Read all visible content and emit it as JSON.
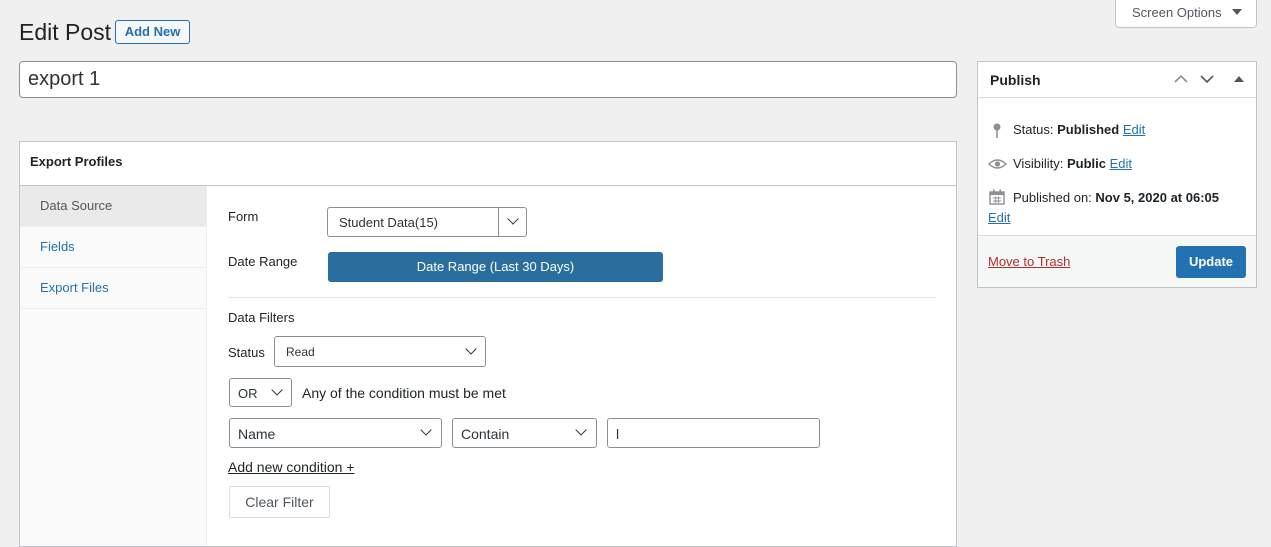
{
  "header": {
    "title": "Edit Post",
    "add_new_label": "Add New",
    "screen_options_label": "Screen Options"
  },
  "post_title": {
    "value": "export 1"
  },
  "export_profiles": {
    "heading": "Export Profiles",
    "tabs": [
      {
        "label": "Data Source",
        "active": true
      },
      {
        "label": "Fields",
        "active": false
      },
      {
        "label": "Export Files",
        "active": false
      }
    ],
    "form_label": "Form",
    "form_value": "Student Data(15)",
    "date_range_label": "Date Range",
    "date_range_button": "Date Range (Last 30 Days)",
    "data_filters_label": "Data Filters",
    "status_label": "Status",
    "status_value": "Read",
    "logic_value": "OR",
    "logic_text": "Any of the condition must be met",
    "condition_field": "Name",
    "condition_operator": "Contain",
    "condition_value": "l",
    "add_condition_label": "Add new condition +",
    "clear_filter_label": "Clear Filter"
  },
  "publish": {
    "heading": "Publish",
    "status_label": "Status:",
    "status_value": "Published",
    "visibility_label": "Visibility:",
    "visibility_value": "Public",
    "published_on_label": "Published on:",
    "published_on_value": "Nov 5, 2020 at 06:05",
    "edit_label": "Edit",
    "trash_label": "Move to Trash",
    "update_label": "Update"
  },
  "colors": {
    "primary": "#2271b1",
    "date_range_bg": "#2a6e9e",
    "trash_red": "#b32d2e",
    "page_bg": "#f0f0f1"
  }
}
